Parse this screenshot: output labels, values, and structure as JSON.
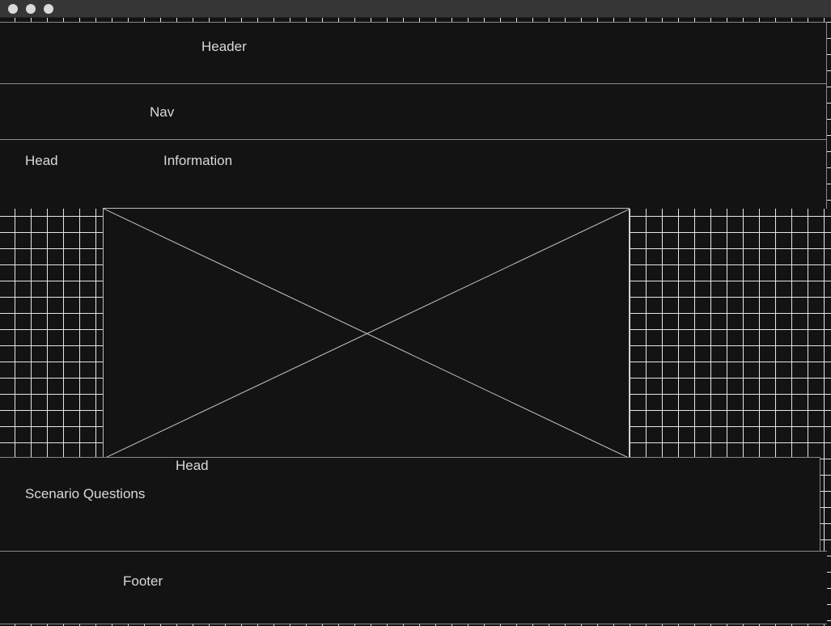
{
  "window": {
    "controls": [
      "close",
      "minimize",
      "maximize"
    ]
  },
  "header": {
    "label": "Header"
  },
  "nav": {
    "label": "Nav"
  },
  "info": {
    "head_label": "Head",
    "info_label": "Information"
  },
  "image_placeholder": {
    "icon": "image-placeholder-icon"
  },
  "scenario": {
    "head_label": "Head",
    "title": "Scenario Questions"
  },
  "footer": {
    "label": "Footer"
  },
  "colors": {
    "background": "#131313",
    "titlebar": "#363636",
    "grid": "#e6e6e6",
    "text": "#d9d9d9",
    "border": "#8a8a8a"
  }
}
